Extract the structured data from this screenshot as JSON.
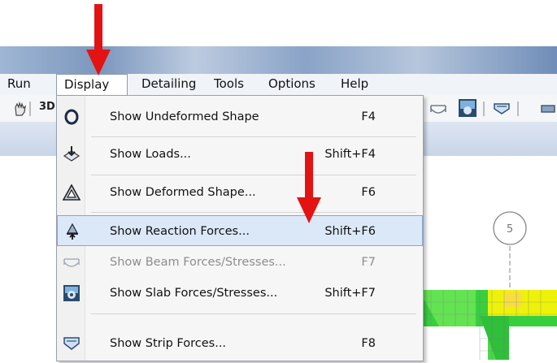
{
  "menubar": {
    "items": [
      {
        "label": "Run"
      },
      {
        "label": "Display"
      },
      {
        "label": "Detailing"
      },
      {
        "label": "Tools"
      },
      {
        "label": "Options"
      },
      {
        "label": "Help"
      }
    ]
  },
  "toolbar": {
    "text_3d": "3D"
  },
  "display_menu": {
    "items": [
      {
        "label": "Show Undeformed Shape",
        "shortcut": "F4",
        "icon": "undeformed-shape-icon",
        "enabled": true
      },
      {
        "label": "Show Loads...",
        "shortcut": "Shift+F4",
        "icon": "loads-icon",
        "enabled": true
      },
      {
        "label": "Show Deformed Shape...",
        "shortcut": "F6",
        "icon": "deformed-shape-icon",
        "enabled": true
      },
      {
        "label": "Show Reaction Forces...",
        "shortcut": "Shift+F6",
        "icon": "reaction-forces-icon",
        "enabled": true,
        "highlighted": true
      },
      {
        "label": "Show Beam Forces/Stresses...",
        "shortcut": "F7",
        "icon": "beam-forces-icon",
        "enabled": false
      },
      {
        "label": "Show Slab Forces/Stresses...",
        "shortcut": "Shift+F7",
        "icon": "slab-forces-icon",
        "enabled": true
      },
      {
        "label": "Show Strip Forces...",
        "shortcut": "F8",
        "icon": "strip-forces-icon",
        "enabled": true
      }
    ]
  },
  "canvas": {
    "grid_label": "5"
  },
  "colors": {
    "highlight": "#dbe8f7",
    "arrow": "#e31313",
    "slab_green": "#3cd33c",
    "slab_yellow": "#eef20a"
  }
}
